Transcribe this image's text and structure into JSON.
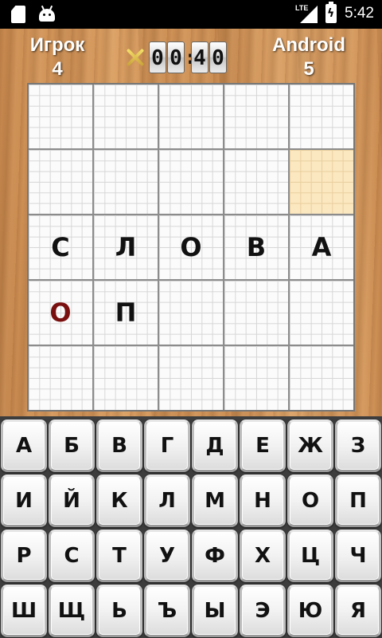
{
  "status_bar": {
    "network": "LTE",
    "time": "5:42",
    "icons": [
      "sd-card-icon",
      "android-icon",
      "signal-icon",
      "battery-charging-icon"
    ]
  },
  "header": {
    "player": {
      "name": "Игрок",
      "score": "4"
    },
    "opponent": {
      "name": "Android",
      "score": "5"
    },
    "timer": {
      "minutes": [
        "0",
        "0"
      ],
      "seconds": [
        "4",
        "0"
      ],
      "separator": ":"
    }
  },
  "board": {
    "rows": [
      [
        "",
        "",
        "",
        "",
        ""
      ],
      [
        "",
        "",
        "",
        "",
        ""
      ],
      [
        "С",
        "Л",
        "О",
        "В",
        "А"
      ],
      [
        "О",
        "П",
        "",
        "",
        ""
      ],
      [
        "",
        "",
        "",
        "",
        ""
      ]
    ],
    "highlighted_cell": {
      "row": 1,
      "col": 4
    },
    "new_letter_cell": {
      "row": 3,
      "col": 0
    },
    "colors": {
      "highlight": "#fbe7c0",
      "new_letter": "#7a0f0f"
    }
  },
  "keyboard": {
    "rows": [
      [
        "А",
        "Б",
        "В",
        "Г",
        "Д",
        "Е",
        "Ж",
        "З"
      ],
      [
        "И",
        "Й",
        "К",
        "Л",
        "М",
        "Н",
        "О",
        "П"
      ],
      [
        "Р",
        "С",
        "Т",
        "У",
        "Ф",
        "Х",
        "Ц",
        "Ч"
      ],
      [
        "Ш",
        "Щ",
        "Ь",
        "Ъ",
        "Ы",
        "Э",
        "Ю",
        "Я"
      ]
    ]
  }
}
